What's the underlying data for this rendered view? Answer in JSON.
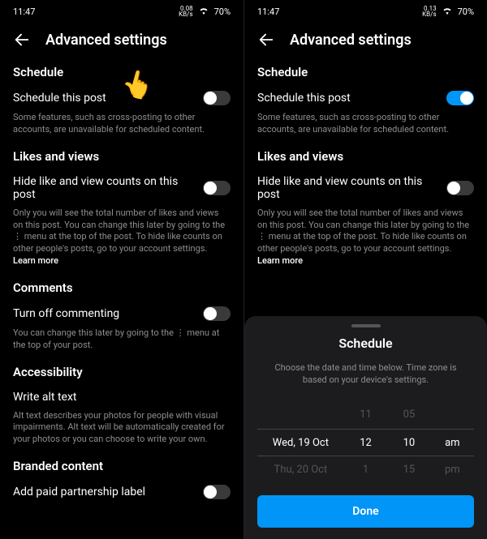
{
  "status": {
    "time": "11:47",
    "net_left": "0.08",
    "net_right": "0.13",
    "net_suffix": "KB/s",
    "wifi_icon": "wifi",
    "battery": "70%"
  },
  "header": {
    "title": "Advanced settings"
  },
  "schedule": {
    "section": "Schedule",
    "row_label": "Schedule this post",
    "helper": "Some features, such as cross-posting to other accounts, are unavailable for scheduled content."
  },
  "likes": {
    "section": "Likes and views",
    "row_label": "Hide like and view counts on this post",
    "helper": "Only you will see the total number of likes and views on this post. You can change this later by going to the ⋮ menu at the top of the post. To hide like counts on other people's posts, go to your account settings. ",
    "learn_more": "Learn more"
  },
  "comments": {
    "section": "Comments",
    "row_label": "Turn off commenting",
    "helper": "You can change this later by going to the  ⋮  menu at the top of your post."
  },
  "accessibility": {
    "section": "Accessibility",
    "row_label": "Write alt text",
    "helper": "Alt text describes your photos for people with visual impairments. Alt text will be automatically created for your photos or you can choose to write your own."
  },
  "branded": {
    "section": "Branded content",
    "row_label": "Add paid partnership label"
  },
  "sheet": {
    "title": "Schedule",
    "helper": "Choose the date and time below. Time zone is based on your device's settings.",
    "done": "Done",
    "date_prev": "",
    "date_sel": "Wed, 19 Oct",
    "date_next": "Thu, 20 Oct",
    "hour_prev": "11",
    "hour_sel": "12",
    "hour_next": "1",
    "min_prev": "05",
    "min_sel": "10",
    "min_next": "15",
    "ampm_prev": "",
    "ampm_sel": "am",
    "ampm_next": "pm"
  }
}
